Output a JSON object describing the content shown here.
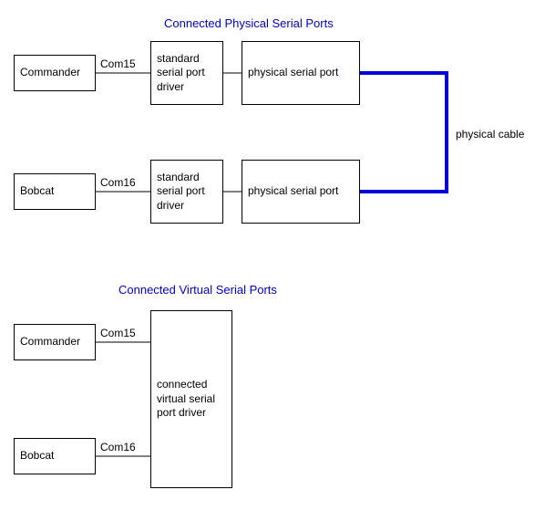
{
  "section1": {
    "title": "Connected Physical Serial Ports",
    "row1": {
      "app": "Commander",
      "port": "Com15",
      "driver": "standard serial port driver",
      "phys": "physical serial port"
    },
    "row2": {
      "app": "Bobcat",
      "port": "Com16",
      "driver": "standard serial port driver",
      "phys": "physical serial port"
    },
    "cable": "physical cable"
  },
  "section2": {
    "title": "Connected Virtual Serial Ports",
    "row1": {
      "app": "Commander",
      "port": "Com15"
    },
    "row2": {
      "app": "Bobcat",
      "port": "Com16"
    },
    "driver": "connected virtual serial port driver"
  }
}
